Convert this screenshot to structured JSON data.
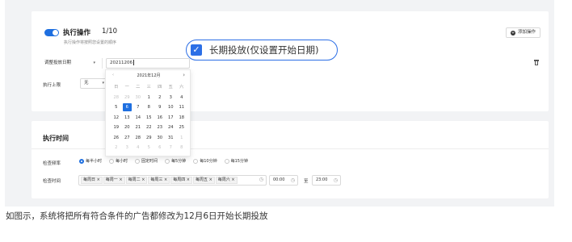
{
  "colors": {
    "accent": "#1e6fe0",
    "callout_border": "#2c6fe6",
    "panel_bg": "#f2f3f5"
  },
  "section1": {
    "title": "执行操作",
    "count": "1/10",
    "subtitle": "执行操作将按照您设置的顺序",
    "add_button": "添加操作",
    "action_select": "调整投放日期",
    "date_value": "20211206",
    "limit_label": "执行上限",
    "limit_value": "无"
  },
  "callout": {
    "checkbox_icon": "checkmark-icon",
    "label": "长期投放(仅设置开始日期)"
  },
  "calendar": {
    "month_label": "2021年12月",
    "prev": "‹",
    "next": "›",
    "weekdays": [
      "日",
      "一",
      "二",
      "三",
      "四",
      "五",
      "六"
    ],
    "weeks": [
      [
        "28",
        "29",
        "30",
        "1",
        "2",
        "3",
        "4"
      ],
      [
        "5",
        "6",
        "7",
        "8",
        "9",
        "10",
        "11"
      ],
      [
        "12",
        "13",
        "14",
        "15",
        "16",
        "17",
        "18"
      ],
      [
        "19",
        "20",
        "21",
        "22",
        "23",
        "24",
        "25"
      ],
      [
        "26",
        "27",
        "28",
        "29",
        "30",
        "31",
        "1"
      ],
      [
        "2",
        "3",
        "4",
        "5",
        "6",
        "7",
        "8"
      ]
    ],
    "selected_day": "6"
  },
  "section2": {
    "title": "执行时间",
    "check_label": "检查频率",
    "options": [
      "每半小时",
      "每小时",
      "固定时间",
      "每5分钟",
      "每10分钟",
      "每15分钟"
    ],
    "selected_option": "每半小时",
    "time_label": "检查时间",
    "days": [
      "每周日",
      "每周一",
      "每周二",
      "每周三",
      "每周四",
      "每周五",
      "每周六"
    ],
    "start_time": "00:00",
    "to_label": "至",
    "end_time": "23:00"
  },
  "caption": "如图示，系统将把所有符合条件的广告都修改为12月6日开始长期投放"
}
